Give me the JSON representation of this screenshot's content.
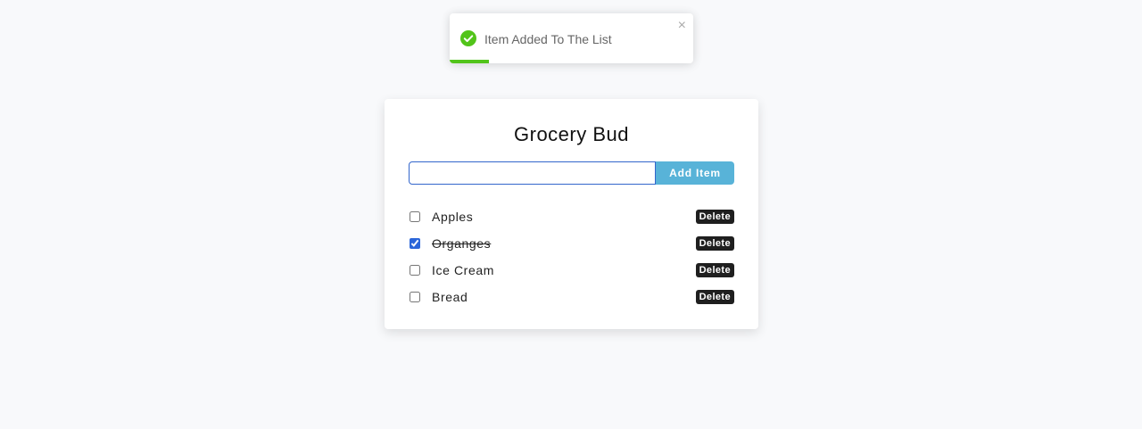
{
  "toast": {
    "message": "Item Added To The List",
    "close_glyph": "×",
    "icon": "check-circle-icon",
    "progress": 0.16,
    "colors": {
      "success": "#52c41a",
      "progress": "#52c41a"
    }
  },
  "app": {
    "title": "Grocery Bud",
    "input": {
      "value": "",
      "placeholder": ""
    },
    "add_label": "Add Item",
    "colors": {
      "accent": "#58b3d8",
      "input_border": "#3366cc",
      "delete_bg": "#1f1f1f"
    }
  },
  "items": [
    {
      "name": "Apples",
      "completed": false,
      "delete_label": "Delete"
    },
    {
      "name": "Organges",
      "completed": true,
      "delete_label": "Delete"
    },
    {
      "name": "Ice Cream",
      "completed": false,
      "delete_label": "Delete"
    },
    {
      "name": "Bread",
      "completed": false,
      "delete_label": "Delete"
    }
  ]
}
